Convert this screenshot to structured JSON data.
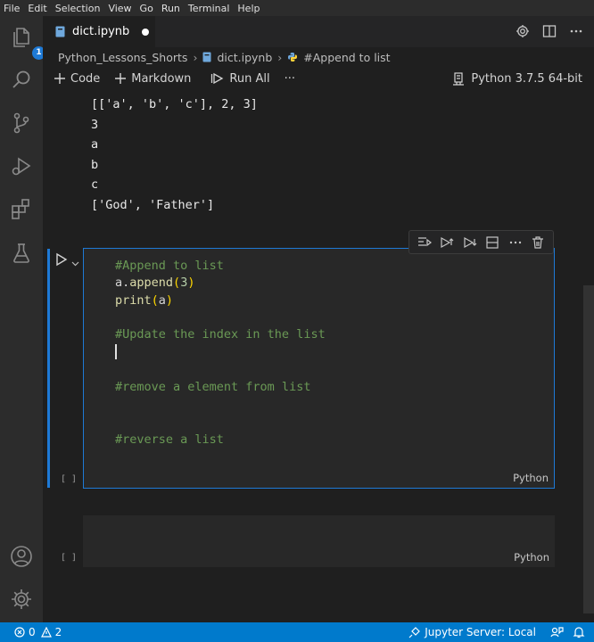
{
  "menu": [
    "File",
    "Edit",
    "Selection",
    "View",
    "Go",
    "Run",
    "Terminal",
    "Help"
  ],
  "activity_bar": {
    "icons": [
      "explorer-icon",
      "search-icon",
      "source-control-icon",
      "run-debug-icon",
      "extensions-icon",
      "testing-icon",
      "account-icon",
      "settings-gear-icon"
    ],
    "explorer_badge": "1"
  },
  "tab": {
    "filename": "dict.ipynb",
    "modified": true
  },
  "breadcrumb": {
    "folder": "Python_Lessons_Shorts",
    "file": "dict.ipynb",
    "section": "#Append to list"
  },
  "toolbar": {
    "code_label": "Code",
    "markdown_label": "Markdown",
    "run_all_label": "Run All",
    "more_label": "···",
    "kernel_label": "Python 3.7.5 64-bit"
  },
  "output_lines": [
    "[['a', 'b', 'c'], 2, 3]",
    "3",
    "a",
    "b",
    "c",
    "['God', 'Father']"
  ],
  "cell1": {
    "execution_count": "[ ]",
    "language": "Python",
    "line1_comment": "#Append to list",
    "line2_obj": "a.",
    "line2_fn": "append",
    "line2_open": "(",
    "line2_num": "3",
    "line2_close": ")",
    "line3_fn": "print",
    "line3_open": "(",
    "line3_arg": "a",
    "line3_close": ")",
    "line5_comment": "#Update the index in the list",
    "line8_comment": "#remove a element from list",
    "line11_comment": "#reverse a list"
  },
  "cell2": {
    "execution_count": "[ ]",
    "language": "Python"
  },
  "status": {
    "errors": "0",
    "warnings": "2",
    "jupyter_server": "Jupyter Server: Local"
  },
  "colors": {
    "accent": "#1e7ad6",
    "status_bar": "#007acc",
    "comment": "#6a9955",
    "function": "#dcdcaa",
    "bracket": "#ffd700"
  }
}
